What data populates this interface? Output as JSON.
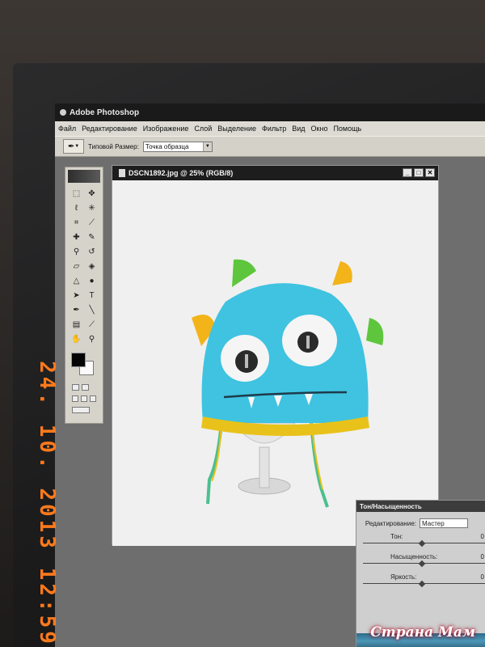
{
  "app": {
    "title": "Adobe Photoshop"
  },
  "menu": {
    "items": [
      "Файл",
      "Редактирование",
      "Изображение",
      "Слой",
      "Выделение",
      "Фильтр",
      "Вид",
      "Окно",
      "Помощь"
    ]
  },
  "options_bar": {
    "sample_size_label": "Типовой Размер:",
    "sample_size_value": "Точка образца"
  },
  "document": {
    "title": "DSCN1892.jpg @ 25% (RGB/8)",
    "zoom": "25%"
  },
  "window_buttons": {
    "minimize": "_",
    "maximize": "□",
    "close": "✕"
  },
  "hue_dialog": {
    "title": "Тон/Насыщенность",
    "edit_label": "Редактирование:",
    "edit_value": "Мастер",
    "hue_label": "Тон:",
    "hue_value": "0",
    "saturation_label": "Насыщенность:",
    "saturation_value": "0",
    "lightness_label": "Яркость:",
    "lightness_value": "0"
  },
  "datestamp": "24. 10. 2013  12:59",
  "watermark": {
    "text": "Страна Мам"
  },
  "colors": {
    "hat": "#3fc3e0",
    "hat_brim": "#e8c21a",
    "horn_green": "#5dc63c",
    "horn_yellow": "#f2b418",
    "datestamp": "#ff7a1c"
  },
  "icons": {
    "eyedropper": "eyedropper-icon",
    "marquee": "marquee-icon",
    "move": "move-icon",
    "lasso": "lasso-icon",
    "magic_wand": "magic-wand-icon",
    "crop": "crop-icon",
    "slice": "slice-icon",
    "healing": "healing-brush-icon",
    "brush": "brush-icon",
    "stamp": "clone-stamp-icon",
    "history": "history-brush-icon",
    "eraser": "eraser-icon",
    "bucket": "paint-bucket-icon",
    "blur": "blur-icon",
    "dodge": "dodge-icon",
    "path": "path-select-icon",
    "type": "type-icon",
    "pen": "pen-icon",
    "line": "line-icon",
    "notes": "notes-icon",
    "hand": "hand-icon",
    "zoom": "zoom-icon"
  }
}
